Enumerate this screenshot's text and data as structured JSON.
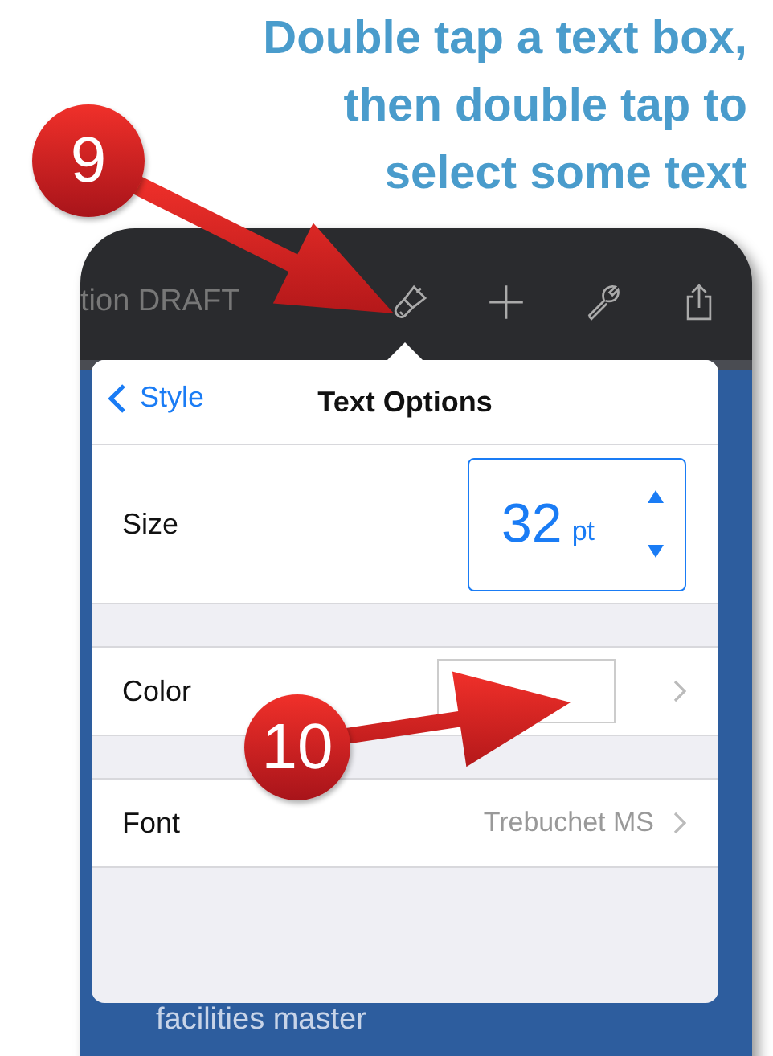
{
  "caption": "Double tap a text box,\nthen double tap to\nselect some text",
  "markers": [
    {
      "number": "9"
    },
    {
      "number": "10"
    }
  ],
  "toolbar": {
    "title": "tion DRAFT"
  },
  "popover": {
    "back": "Style",
    "title": "Text Options",
    "rows": [
      {
        "kind": "stepper",
        "label": "Size",
        "value": "32",
        "unit": "pt"
      },
      {
        "kind": "swatch",
        "label": "Color"
      },
      {
        "kind": "value",
        "label": "Font",
        "value": "Trebuchet MS"
      }
    ]
  },
  "slide_text": "facilities master"
}
